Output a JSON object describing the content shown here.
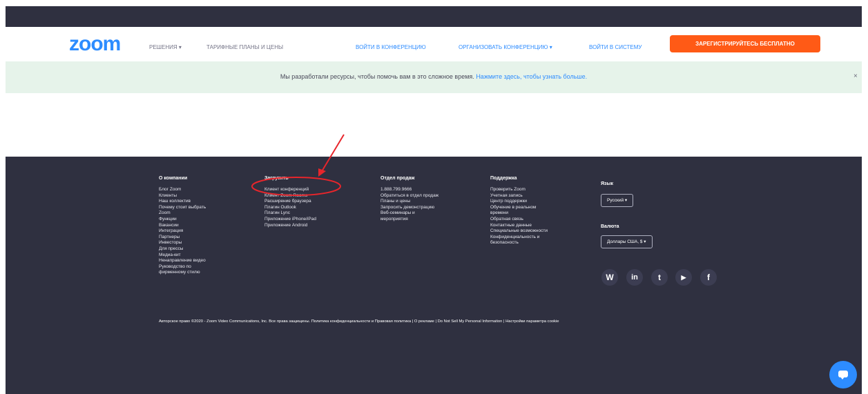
{
  "nav": {
    "logo": "zoom",
    "links": [
      "РЕШЕНИЯ ▾",
      "ТАРИФНЫЕ ПЛАНЫ И ЦЕНЫ",
      "ВОЙТИ В КОНФЕРЕНЦИЮ",
      "ОРГАНИЗОВАТЬ КОНФЕРЕНЦИЮ ▾",
      "ВОЙТИ В СИСТЕМУ"
    ],
    "signup": "ЗАРЕГИСТРИРУЙТЕСЬ БЕСПЛАТНО"
  },
  "banner": {
    "text": "Мы разработали ресурсы, чтобы помочь вам в это сложное время.",
    "link": "Нажмите здесь, чтобы узнать больше.",
    "close": "×"
  },
  "footer": {
    "about": {
      "head": "О компании",
      "items": [
        "Блог Zoom",
        "Клиенты",
        "Наш коллектив",
        "Почему стоит выбрать",
        "Zoom",
        "Функции",
        "Вакансии",
        "Интеграция",
        "Партнеры",
        "Инвесторы",
        "Для прессы",
        "Медиа-кит",
        "Ненаправление видео",
        "Руководство по",
        "фирменному стилю"
      ]
    },
    "download": {
      "head": "Загрузить",
      "items": [
        "Клиент конференций",
        "Клиент Zoom Rooms",
        "Расширение браузера",
        "Плагин Outlook",
        "Плагин Lync",
        "Приложение iPhone/iPad",
        "Приложение Android"
      ]
    },
    "sales": {
      "head": "Отдел продаж",
      "items": [
        "1.888.799.9666",
        "Обратиться в отдел продаж",
        "Планы и цены",
        "Запросить демонстрацию",
        "Веб-семинары и",
        "мероприятия"
      ]
    },
    "support": {
      "head": "Поддержка",
      "items": [
        "Проверить Zoom",
        "Учетная запись",
        "Центр поддержки",
        "Обучение в реальном",
        "времени",
        "Обратная связь",
        "Контактные данные",
        "Специальные возможности",
        "Конфиденциальность и",
        "безопасность"
      ]
    },
    "language": {
      "label": "Язык",
      "value": "Русский ▾"
    },
    "currency": {
      "label": "Валюта",
      "value": "Доллары США, $ ▾"
    },
    "social": [
      {
        "icon": "wordpress-icon",
        "glyph": "W"
      },
      {
        "icon": "linkedin-icon",
        "glyph": "in"
      },
      {
        "icon": "twitter-icon",
        "glyph": "t"
      },
      {
        "icon": "youtube-icon",
        "glyph": "▶"
      },
      {
        "icon": "facebook-icon",
        "glyph": "f"
      }
    ],
    "copyright": "Авторское право ©2020 - Zoom Video Communications, Inc. Все права защищены.  Политика конфиденциальности и Правовая политика  |  О рекламе  |  Do Not Sell My Personal Information  |  Настройки параметра cookie"
  },
  "colors": {
    "brand_blue": "#2d8cff",
    "signup_orange": "#ff5a16",
    "footer_bg": "#2f3040",
    "banner_bg": "#e6f3ea",
    "annotation_red": "#e8252b"
  }
}
